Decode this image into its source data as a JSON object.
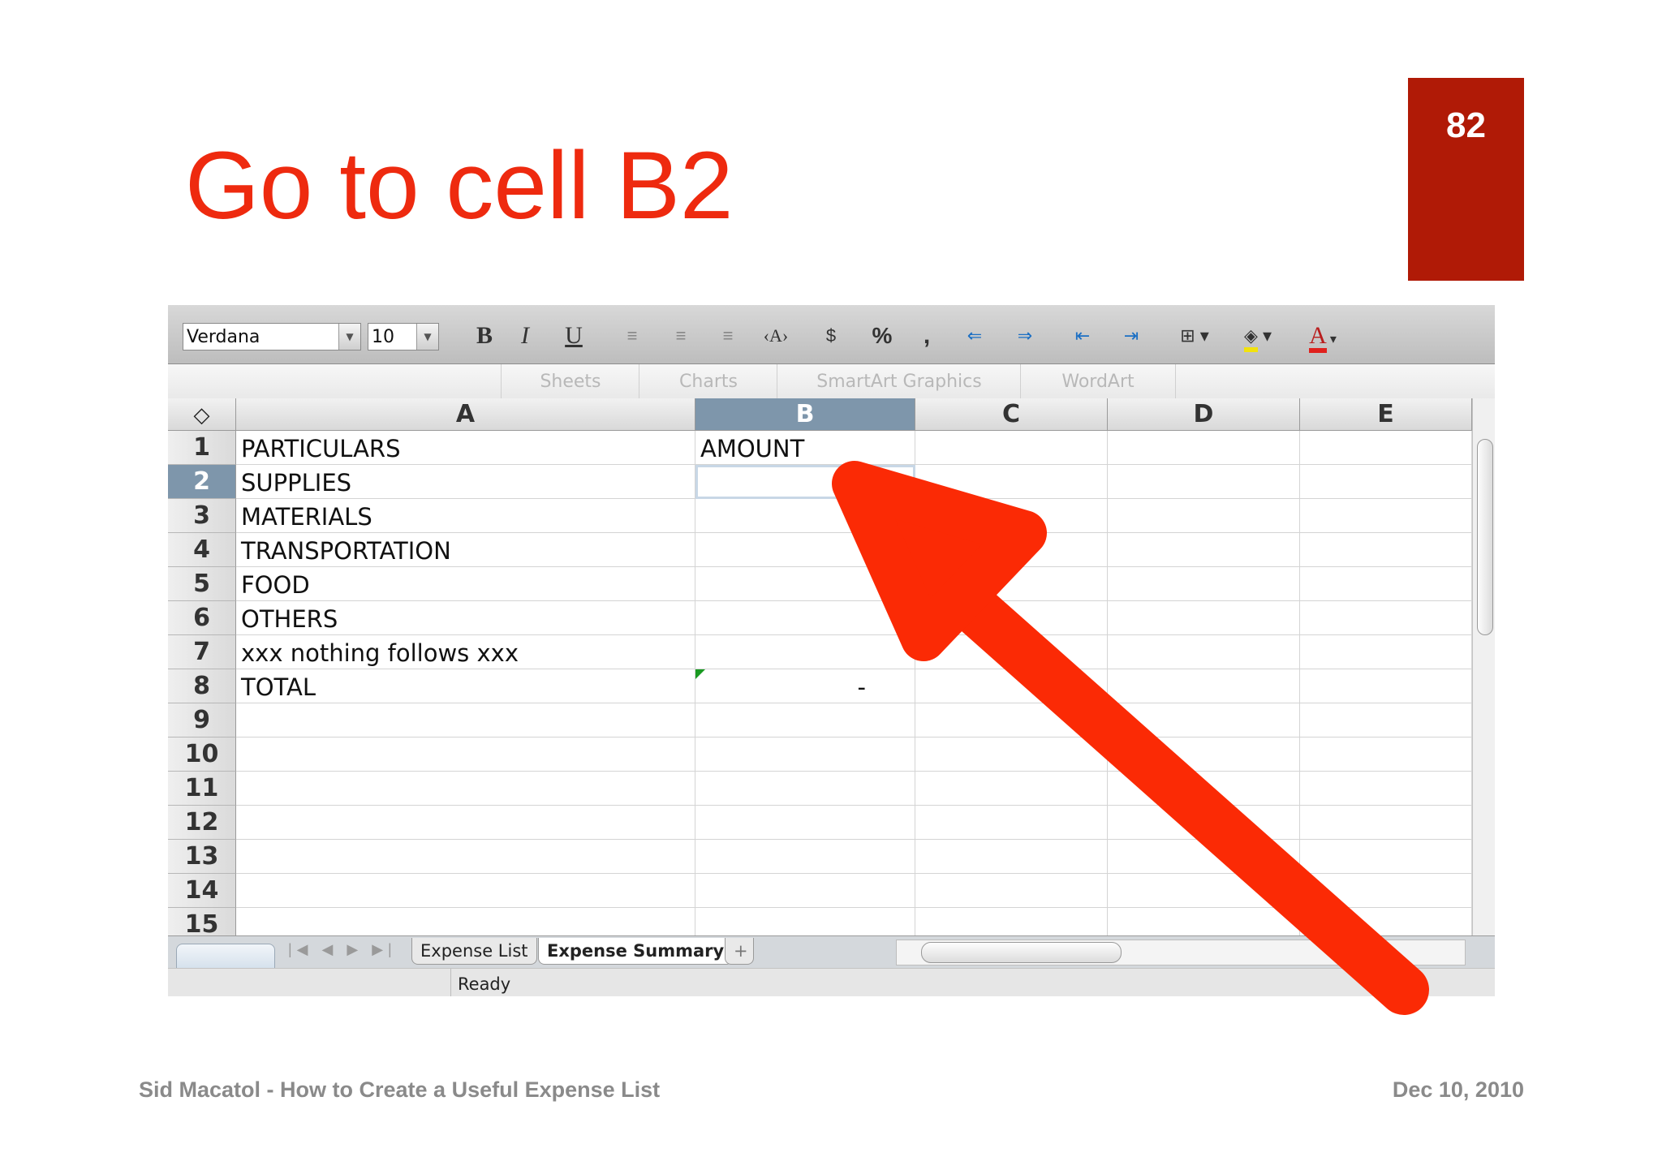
{
  "slide": {
    "title": "Go to cell B2",
    "page_number": "82",
    "footer_left": "Sid Macatol - How to Create a Useful Expense List",
    "footer_right": "Dec 10, 2010",
    "accent_color": "#ee2a0f",
    "badge_color": "#b01a06"
  },
  "toolbar": {
    "font_name": "Verdana",
    "font_size": "10",
    "bold": "B",
    "italic": "I",
    "underline": "U",
    "percent": "%",
    "comma": ",",
    "text_color_label": "A",
    "icons": [
      "align-left-icon",
      "align-center-icon",
      "align-right-icon",
      "wrap-text-icon",
      "currency-icon",
      "percent-icon",
      "comma-style-icon",
      "increase-decimal-icon",
      "decrease-decimal-icon",
      "decrease-indent-icon",
      "increase-indent-icon",
      "borders-icon",
      "fill-color-icon",
      "font-color-icon"
    ]
  },
  "ribbon": {
    "tabs": [
      "Sheets",
      "Charts",
      "SmartArt Graphics",
      "WordArt"
    ]
  },
  "grid": {
    "corner_symbol": "◇",
    "columns": [
      "A",
      "B",
      "C",
      "D",
      "E"
    ],
    "selected_column": "B",
    "selected_row": "2",
    "rows": [
      {
        "num": "1",
        "a": "PARTICULARS",
        "b": "AMOUNT"
      },
      {
        "num": "2",
        "a": "SUPPLIES",
        "b": ""
      },
      {
        "num": "3",
        "a": "MATERIALS",
        "b": ""
      },
      {
        "num": "4",
        "a": "TRANSPORTATION",
        "b": ""
      },
      {
        "num": "5",
        "a": "FOOD",
        "b": ""
      },
      {
        "num": "6",
        "a": "OTHERS",
        "b": ""
      },
      {
        "num": "7",
        "a": "xxx nothing follows xxx",
        "b": ""
      },
      {
        "num": "8",
        "a": "TOTAL",
        "b": "-"
      },
      {
        "num": "9",
        "a": "",
        "b": ""
      },
      {
        "num": "10",
        "a": "",
        "b": ""
      },
      {
        "num": "11",
        "a": "",
        "b": ""
      },
      {
        "num": "12",
        "a": "",
        "b": ""
      },
      {
        "num": "13",
        "a": "",
        "b": ""
      },
      {
        "num": "14",
        "a": "",
        "b": ""
      },
      {
        "num": "15",
        "a": "",
        "b": ""
      }
    ]
  },
  "sheets": {
    "tabs": [
      "Expense List",
      "Expense Summary"
    ],
    "active": "Expense Summary",
    "add_label": "+"
  },
  "status": {
    "text": "Ready"
  },
  "annotation": {
    "arrow_color": "#fb2a05",
    "target_cell": "B2"
  }
}
